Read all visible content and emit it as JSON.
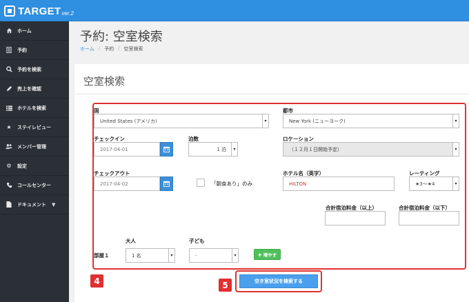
{
  "app": {
    "logo_text": "TARGET",
    "logo_ver": "ver.2"
  },
  "sidebar": {
    "items": [
      {
        "label": "ホーム",
        "icon": "home-icon"
      },
      {
        "label": "予約",
        "icon": "document-icon"
      },
      {
        "label": "予約を検索",
        "icon": "search-icon"
      },
      {
        "label": "売上を確認",
        "icon": "pencil-icon"
      },
      {
        "label": "ホテルを検索",
        "icon": "list-icon"
      },
      {
        "label": "ステイレビュー",
        "icon": "star-icon"
      },
      {
        "label": "メンバー管理",
        "icon": "users-icon"
      },
      {
        "label": "設定",
        "icon": "gear-icon"
      },
      {
        "label": "コールセンター",
        "icon": "phone-icon"
      },
      {
        "label": "ドキュメント",
        "icon": "file-icon"
      }
    ]
  },
  "page": {
    "title": "予約: 空室検索",
    "breadcrumb": [
      "ホーム",
      "予約",
      "空室検索"
    ]
  },
  "form": {
    "card_title": "空室検索",
    "country_label": "国",
    "country_value": "United States (アメリカ)",
    "city_label": "都市",
    "city_value": "New York (ニューヨーク)",
    "checkin_label": "チェックイン",
    "checkin_value": "2017-04-01",
    "nights_label": "泊数",
    "nights_value": "1 泊",
    "location_label": "ロケーション",
    "location_value": "（１２月１日開始予定）",
    "checkout_label": "チェックアウト",
    "checkout_value": "2017-04-02",
    "breakfast_label": "「朝食あり」のみ",
    "hotel_name_label": "ホテル名（英字）",
    "hotel_name_value": "HILTON",
    "rating_label": "レーティング",
    "rating_value": "★3〜★4",
    "total_min_label": "合計宿泊料金（以上）",
    "total_max_label": "合計宿泊料金（以下）",
    "adults_label": "大人",
    "children_label": "子ども",
    "room_label": "部屋１",
    "adults_value": "1 名",
    "children_value": "-",
    "add_button": "✚ 増やす"
  },
  "annotations": {
    "badge_4": "4",
    "badge_5": "5"
  },
  "actions": {
    "search_button": "空き室状況を検索する"
  },
  "colors": {
    "header": "#2f8fe0",
    "sidebar": "#2b3036",
    "highlight": "#e03030",
    "primary": "#4aa0ec",
    "success": "#4fc05a"
  }
}
